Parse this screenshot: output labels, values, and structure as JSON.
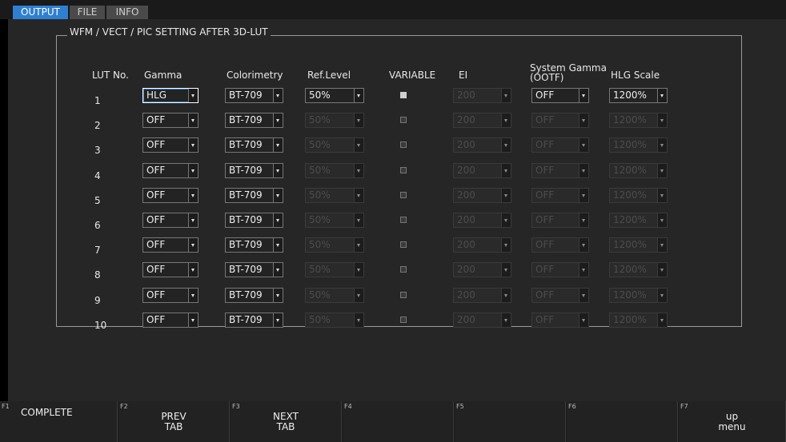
{
  "tabs": [
    {
      "label": "OUTPUT",
      "active": true
    },
    {
      "label": "FILE",
      "active": false
    },
    {
      "label": "INFO",
      "active": false
    }
  ],
  "group": {
    "title": "WFM / VECT / PIC SETTING AFTER 3D-LUT",
    "headers": {
      "lut_no": "LUT No.",
      "gamma": "Gamma",
      "colorimetry": "Colorimetry",
      "ref_level": "Ref.Level",
      "variable": "VARIABLE",
      "ei": "EI",
      "system_gamma_line1": "System Gamma",
      "system_gamma_line2": "(OOTF)",
      "hlg_scale": "HLG Scale"
    },
    "rows": [
      {
        "lut_no": "1",
        "gamma": "HLG",
        "colorimetry": "BT-709",
        "ref_level": "50%",
        "variable": true,
        "ei": "200",
        "system_gamma": "OFF",
        "hlg_scale": "1200%"
      },
      {
        "lut_no": "2",
        "gamma": "OFF",
        "colorimetry": "BT-709",
        "ref_level": "50%",
        "variable": false,
        "ei": "200",
        "system_gamma": "OFF",
        "hlg_scale": "1200%"
      },
      {
        "lut_no": "3",
        "gamma": "OFF",
        "colorimetry": "BT-709",
        "ref_level": "50%",
        "variable": false,
        "ei": "200",
        "system_gamma": "OFF",
        "hlg_scale": "1200%"
      },
      {
        "lut_no": "4",
        "gamma": "OFF",
        "colorimetry": "BT-709",
        "ref_level": "50%",
        "variable": false,
        "ei": "200",
        "system_gamma": "OFF",
        "hlg_scale": "1200%"
      },
      {
        "lut_no": "5",
        "gamma": "OFF",
        "colorimetry": "BT-709",
        "ref_level": "50%",
        "variable": false,
        "ei": "200",
        "system_gamma": "OFF",
        "hlg_scale": "1200%"
      },
      {
        "lut_no": "6",
        "gamma": "OFF",
        "colorimetry": "BT-709",
        "ref_level": "50%",
        "variable": false,
        "ei": "200",
        "system_gamma": "OFF",
        "hlg_scale": "1200%"
      },
      {
        "lut_no": "7",
        "gamma": "OFF",
        "colorimetry": "BT-709",
        "ref_level": "50%",
        "variable": false,
        "ei": "200",
        "system_gamma": "OFF",
        "hlg_scale": "1200%"
      },
      {
        "lut_no": "8",
        "gamma": "OFF",
        "colorimetry": "BT-709",
        "ref_level": "50%",
        "variable": false,
        "ei": "200",
        "system_gamma": "OFF",
        "hlg_scale": "1200%"
      },
      {
        "lut_no": "9",
        "gamma": "OFF",
        "colorimetry": "BT-709",
        "ref_level": "50%",
        "variable": false,
        "ei": "200",
        "system_gamma": "OFF",
        "hlg_scale": "1200%"
      },
      {
        "lut_no": "10",
        "gamma": "OFF",
        "colorimetry": "BT-709",
        "ref_level": "50%",
        "variable": false,
        "ei": "200",
        "system_gamma": "OFF",
        "hlg_scale": "1200%"
      }
    ]
  },
  "function_keys": [
    {
      "num": "F1",
      "label": "COMPLETE"
    },
    {
      "num": "F2",
      "label": "PREV\nTAB"
    },
    {
      "num": "F3",
      "label": "NEXT\nTAB"
    },
    {
      "num": "F4",
      "label": ""
    },
    {
      "num": "F5",
      "label": ""
    },
    {
      "num": "F6",
      "label": ""
    },
    {
      "num": "F7",
      "label": "up\nmenu"
    }
  ],
  "colors": {
    "accent": "#2f7fd1",
    "panel": "#262626",
    "background": "#000000"
  }
}
